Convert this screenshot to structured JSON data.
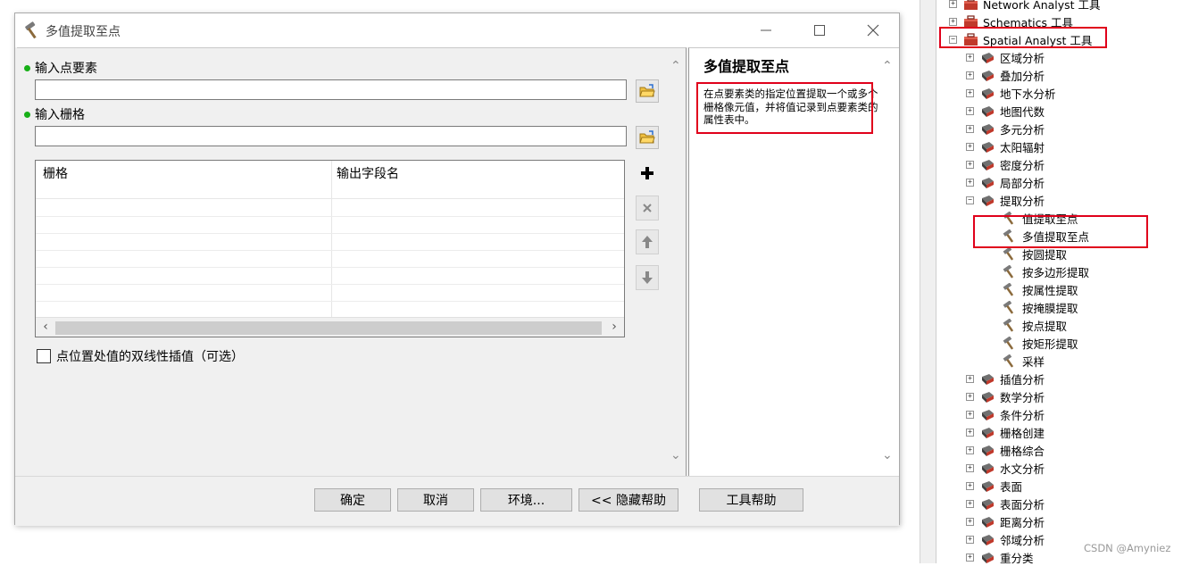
{
  "dialog": {
    "title": "多值提取至点",
    "input_points_label": "输入点要素",
    "input_points_value": "",
    "input_rasters_label": "输入栅格",
    "input_rasters_value": "",
    "grid_columns": [
      "栅格",
      "输出字段名"
    ],
    "checkbox_label": "点位置处值的双线性插值（可选）",
    "help_title": "多值提取至点",
    "help_text": "在点要素类的指定位置提取一个或多个栅格像元值，并将值记录到点要素类的属性表中。",
    "buttons": {
      "ok": "确定",
      "cancel": "取消",
      "env": "环境...",
      "hide_help": "<< 隐藏帮助",
      "tool_help": "工具帮助"
    }
  },
  "tree": {
    "items": [
      {
        "label": "Network Analyst 工具",
        "level": 0,
        "expander": "+",
        "icon": "toolbox-icon"
      },
      {
        "label": "Schematics 工具",
        "level": 0,
        "expander": "+",
        "icon": "toolbox-icon"
      },
      {
        "label": "Spatial Analyst 工具",
        "level": 0,
        "expander": "-",
        "icon": "toolbox-icon"
      },
      {
        "label": "区域分析",
        "level": 1,
        "expander": "+",
        "icon": "toolset-icon"
      },
      {
        "label": "叠加分析",
        "level": 1,
        "expander": "+",
        "icon": "toolset-icon"
      },
      {
        "label": "地下水分析",
        "level": 1,
        "expander": "+",
        "icon": "toolset-icon"
      },
      {
        "label": "地图代数",
        "level": 1,
        "expander": "+",
        "icon": "toolset-icon"
      },
      {
        "label": "多元分析",
        "level": 1,
        "expander": "+",
        "icon": "toolset-icon"
      },
      {
        "label": "太阳辐射",
        "level": 1,
        "expander": "+",
        "icon": "toolset-icon"
      },
      {
        "label": "密度分析",
        "level": 1,
        "expander": "+",
        "icon": "toolset-icon"
      },
      {
        "label": "局部分析",
        "level": 1,
        "expander": "+",
        "icon": "toolset-icon"
      },
      {
        "label": "提取分析",
        "level": 1,
        "expander": "-",
        "icon": "toolset-icon"
      },
      {
        "label": "值提取至点",
        "level": 2,
        "expander": "",
        "icon": "hammer-icon"
      },
      {
        "label": "多值提取至点",
        "level": 2,
        "expander": "",
        "icon": "hammer-icon"
      },
      {
        "label": "按圆提取",
        "level": 2,
        "expander": "",
        "icon": "hammer-icon"
      },
      {
        "label": "按多边形提取",
        "level": 2,
        "expander": "",
        "icon": "hammer-icon"
      },
      {
        "label": "按属性提取",
        "level": 2,
        "expander": "",
        "icon": "hammer-icon"
      },
      {
        "label": "按掩膜提取",
        "level": 2,
        "expander": "",
        "icon": "hammer-icon"
      },
      {
        "label": "按点提取",
        "level": 2,
        "expander": "",
        "icon": "hammer-icon"
      },
      {
        "label": "按矩形提取",
        "level": 2,
        "expander": "",
        "icon": "hammer-icon"
      },
      {
        "label": "采样",
        "level": 2,
        "expander": "",
        "icon": "hammer-icon"
      },
      {
        "label": "插值分析",
        "level": 1,
        "expander": "+",
        "icon": "toolset-icon"
      },
      {
        "label": "数学分析",
        "level": 1,
        "expander": "+",
        "icon": "toolset-icon"
      },
      {
        "label": "条件分析",
        "level": 1,
        "expander": "+",
        "icon": "toolset-icon"
      },
      {
        "label": "栅格创建",
        "level": 1,
        "expander": "+",
        "icon": "toolset-icon"
      },
      {
        "label": "栅格综合",
        "level": 1,
        "expander": "+",
        "icon": "toolset-icon"
      },
      {
        "label": "水文分析",
        "level": 1,
        "expander": "+",
        "icon": "toolset-icon"
      },
      {
        "label": "表面",
        "level": 1,
        "expander": "+",
        "icon": "toolset-icon"
      },
      {
        "label": "表面分析",
        "level": 1,
        "expander": "+",
        "icon": "toolset-icon"
      },
      {
        "label": "距离分析",
        "level": 1,
        "expander": "+",
        "icon": "toolset-icon"
      },
      {
        "label": "邻域分析",
        "level": 1,
        "expander": "+",
        "icon": "toolset-icon"
      },
      {
        "label": "重分类",
        "level": 1,
        "expander": "+",
        "icon": "toolset-icon"
      }
    ]
  },
  "watermark": "CSDN @Amyniez",
  "colors": {
    "highlight": "#e0001b",
    "required_dot": "#18b018"
  }
}
